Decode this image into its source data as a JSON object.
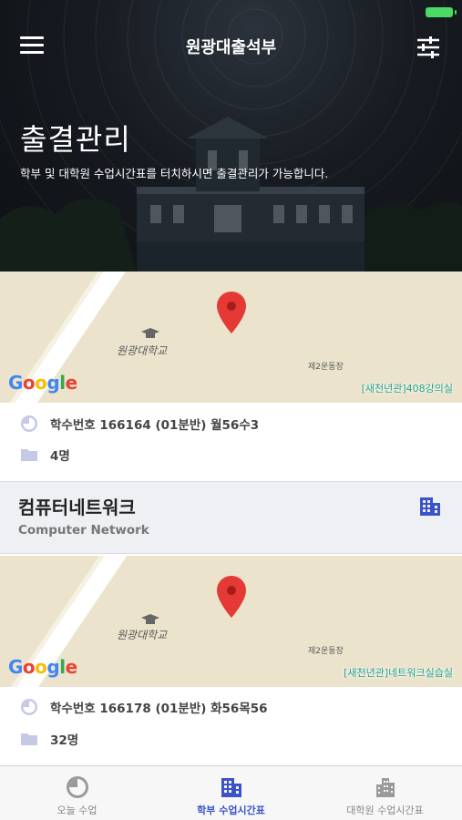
{
  "header": {
    "app_title": "원광대출석부",
    "page_title": "출결관리",
    "page_subtitle": "학부 및 대학원 수업시간표를 터치하시면 출결관리가 가능합니다."
  },
  "courses": [
    {
      "map": {
        "campus_label": "원광대학교",
        "field_label": "제2운동장",
        "room_label": "[새천년관]408강의실",
        "google": "Google"
      },
      "schedule": "학수번호 166164 (01분반) 월56수3",
      "students": "4명"
    },
    {
      "name": "컴퓨터네트워크",
      "name_en": "Computer Network",
      "map": {
        "campus_label": "원광대학교",
        "field_label": "제2운동장",
        "room_label": "[새천년관]네트워크실습실",
        "google": "Google"
      },
      "schedule": "학수번호 166178 (01분반) 화56목56",
      "students": "32명"
    }
  ],
  "tabbar": {
    "tabs": [
      {
        "label": "오늘 수업",
        "icon": "clock-icon",
        "active": false
      },
      {
        "label": "학부 수업시간표",
        "icon": "building-icon",
        "active": true
      },
      {
        "label": "대학원 수업시간표",
        "icon": "city-icon",
        "active": false
      }
    ]
  },
  "colors": {
    "accent": "#3a53c9",
    "room_label": "#21a08a",
    "map_bg": "#ebe3cc",
    "pin": "#e53935",
    "battery": "#4cd964"
  }
}
